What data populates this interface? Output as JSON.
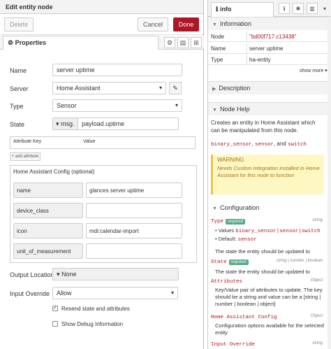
{
  "editor": {
    "title": "Edit entity node",
    "delete_label": "Delete",
    "cancel_label": "Cancel",
    "done_label": "Done",
    "properties_tab": "Properties",
    "fields": {
      "name_label": "Name",
      "name_value": "server uptime",
      "server_label": "Server",
      "server_value": "Home Assistant",
      "type_label": "Type",
      "type_value": "Sensor",
      "state_label": "State",
      "state_prefix": "msg.",
      "state_value": "payload.uptime",
      "attr_key_header": "Attribute Key",
      "attr_value_header": "Value",
      "add_attribute": "+ add attribute",
      "ha_config_title": "Home Assistant Config (optional)",
      "ha_config": [
        {
          "key": "name",
          "value": "glances server uptime"
        },
        {
          "key": "device_class",
          "value": ""
        },
        {
          "key": "icon",
          "value": "mdi:calendar-import"
        },
        {
          "key": "unit_of_measurement",
          "value": ""
        }
      ],
      "output_location_label": "Output Location",
      "output_location_value": "None",
      "input_override_label": "Input Override",
      "input_override_value": "Allow",
      "resend_label": "Resend state and attributes",
      "resend_checked": true,
      "debug_label": "Show Debug Information",
      "debug_checked": false
    }
  },
  "sidebar": {
    "tab_label": "info",
    "information_title": "Information",
    "node_label": "Node",
    "node_value": "\"bd00f717.c13438\"",
    "name_label": "Name",
    "name_value": "server uptime",
    "type_label": "Type",
    "type_value": "ha-entity",
    "show_more": "show more ▾",
    "description_title": "Description",
    "node_help_title": "Node Help",
    "help_text": "Creates an entity in Home Assistant which can be manipulated from this node.",
    "sensor_types": [
      "binary_sensor",
      "sensor",
      "switch"
    ],
    "sensor_joiners": [
      ", ",
      ", and "
    ],
    "warning_title": "WARNING",
    "warning_body": "Needs Custom Integration installed in Home Assistant for this node to function",
    "configuration_title": "Configuration",
    "config": {
      "type_key": "Type",
      "type_badge": "required",
      "type_kind": "string",
      "values_label": "Values",
      "values_value": "binary_sensor|sensor|switch",
      "default_label": "Default:",
      "default_value": "sensor",
      "type_desc": "The state the entity should be updated to",
      "state_key": "State",
      "state_badge": "required",
      "state_kind": "string | number | boolean",
      "state_desc": "The state the entity should be updated to",
      "attributes_key": "Attributes",
      "attributes_kind": "Object",
      "attributes_desc": "Key/Value pair of attributes to update. The key should be a string and value can be a [string | number | boolean | object]",
      "ha_config_key": "Home Assistant Config",
      "ha_config_kind": "Object",
      "ha_config_desc": "Configuration options available for the selected entity",
      "input_override_key": "Input Override",
      "input_override_kind": "string"
    }
  },
  "colors": {
    "done": "#ad1625",
    "mono_red": "#ad1625",
    "warning_bg": "#fff7c2",
    "badge_green": "#55aa88"
  }
}
